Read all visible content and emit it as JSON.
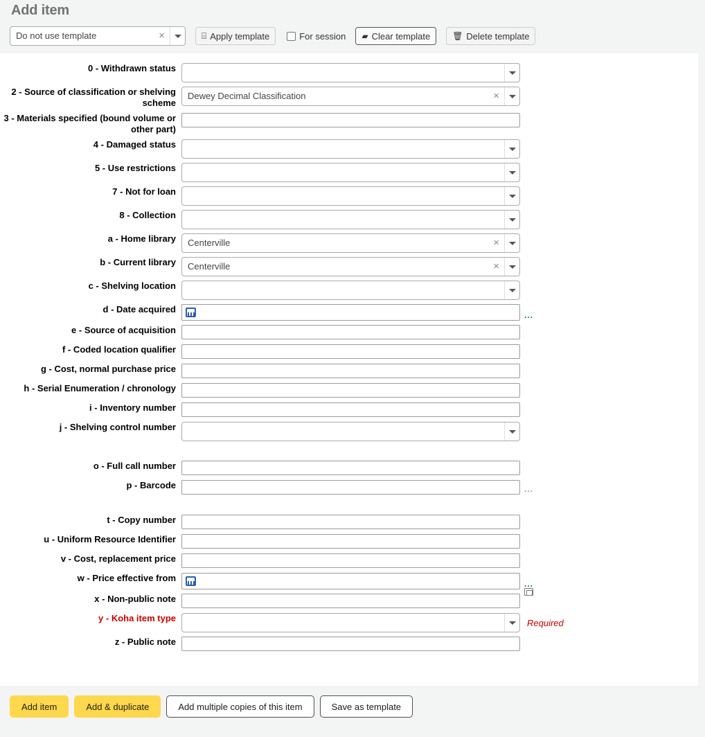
{
  "page": {
    "title": "Add item"
  },
  "template_toolbar": {
    "select": {
      "value": "Do not use template",
      "clear_label": "×"
    },
    "apply_label": "Apply template",
    "for_session_label": "For session",
    "clear_label": "Clear template",
    "delete_label": "Delete template"
  },
  "fields": [
    {
      "label": "0 - Withdrawn status",
      "type": "select",
      "value": "",
      "required": false
    },
    {
      "label": "2 - Source of classification or shelving scheme",
      "type": "select",
      "value": "Dewey Decimal Classification",
      "required": false
    },
    {
      "label": "3 - Materials specified (bound volume or other part)",
      "type": "text",
      "value": "",
      "required": false
    },
    {
      "label": "4 - Damaged status",
      "type": "select",
      "value": "",
      "required": false
    },
    {
      "label": "5 - Use restrictions",
      "type": "select",
      "value": "",
      "required": false
    },
    {
      "label": "7 - Not for loan",
      "type": "select",
      "value": "",
      "required": false
    },
    {
      "label": "8 - Collection",
      "type": "select",
      "value": "",
      "required": false
    },
    {
      "label": "a - Home library",
      "type": "select",
      "value": "Centerville",
      "required": false
    },
    {
      "label": "b - Current library",
      "type": "select",
      "value": "Centerville",
      "required": false
    },
    {
      "label": "c - Shelving location",
      "type": "select",
      "value": "",
      "required": false
    },
    {
      "label": "d - Date acquired",
      "type": "date",
      "value": "",
      "required": false,
      "dots": "green"
    },
    {
      "label": "e - Source of acquisition",
      "type": "text",
      "value": "",
      "required": false
    },
    {
      "label": "f - Coded location qualifier",
      "type": "text",
      "value": "",
      "required": false
    },
    {
      "label": "g - Cost, normal purchase price",
      "type": "text",
      "value": "",
      "required": false
    },
    {
      "label": "h - Serial Enumeration / chronology",
      "type": "text",
      "value": "",
      "required": false
    },
    {
      "label": "i - Inventory number",
      "type": "text",
      "value": "",
      "required": false
    },
    {
      "label": "j - Shelving control number",
      "type": "select",
      "value": "",
      "required": false
    },
    {
      "label": "",
      "type": "spacer",
      "value": "",
      "required": false
    },
    {
      "label": "o - Full call number",
      "type": "text",
      "value": "",
      "required": false
    },
    {
      "label": "p - Barcode",
      "type": "text",
      "value": "",
      "required": false,
      "dots": "gray"
    },
    {
      "label": "",
      "type": "spacer",
      "value": "",
      "required": false
    },
    {
      "label": "t - Copy number",
      "type": "text",
      "value": "",
      "required": false
    },
    {
      "label": "u - Uniform Resource Identifier",
      "type": "text",
      "value": "",
      "required": false
    },
    {
      "label": "v - Cost, replacement price",
      "type": "text",
      "value": "",
      "required": false
    },
    {
      "label": "w - Price effective from",
      "type": "date",
      "value": "",
      "required": false,
      "dots": "green"
    },
    {
      "label": "x - Non-public note",
      "type": "text",
      "value": "",
      "required": false,
      "clone": true
    },
    {
      "label": "y - Koha item type",
      "type": "select",
      "value": "",
      "required": true,
      "required_note": "Required"
    },
    {
      "label": "z - Public note",
      "type": "text",
      "value": "",
      "required": false
    }
  ],
  "actions": [
    {
      "label": "Add item",
      "style": "primary"
    },
    {
      "label": "Add & duplicate",
      "style": "primary"
    },
    {
      "label": "Add multiple copies of this item",
      "style": "default"
    },
    {
      "label": "Save as template",
      "style": "default"
    }
  ],
  "icons": {
    "apply_template": "⌸",
    "clear_template": "▰",
    "delete_template": "🗑",
    "dots": "..."
  },
  "colors": {
    "primary": "#ffd84d",
    "required": "#cc0000",
    "page_bg": "#f3f4f4",
    "panel_bg": "#ffffff"
  }
}
